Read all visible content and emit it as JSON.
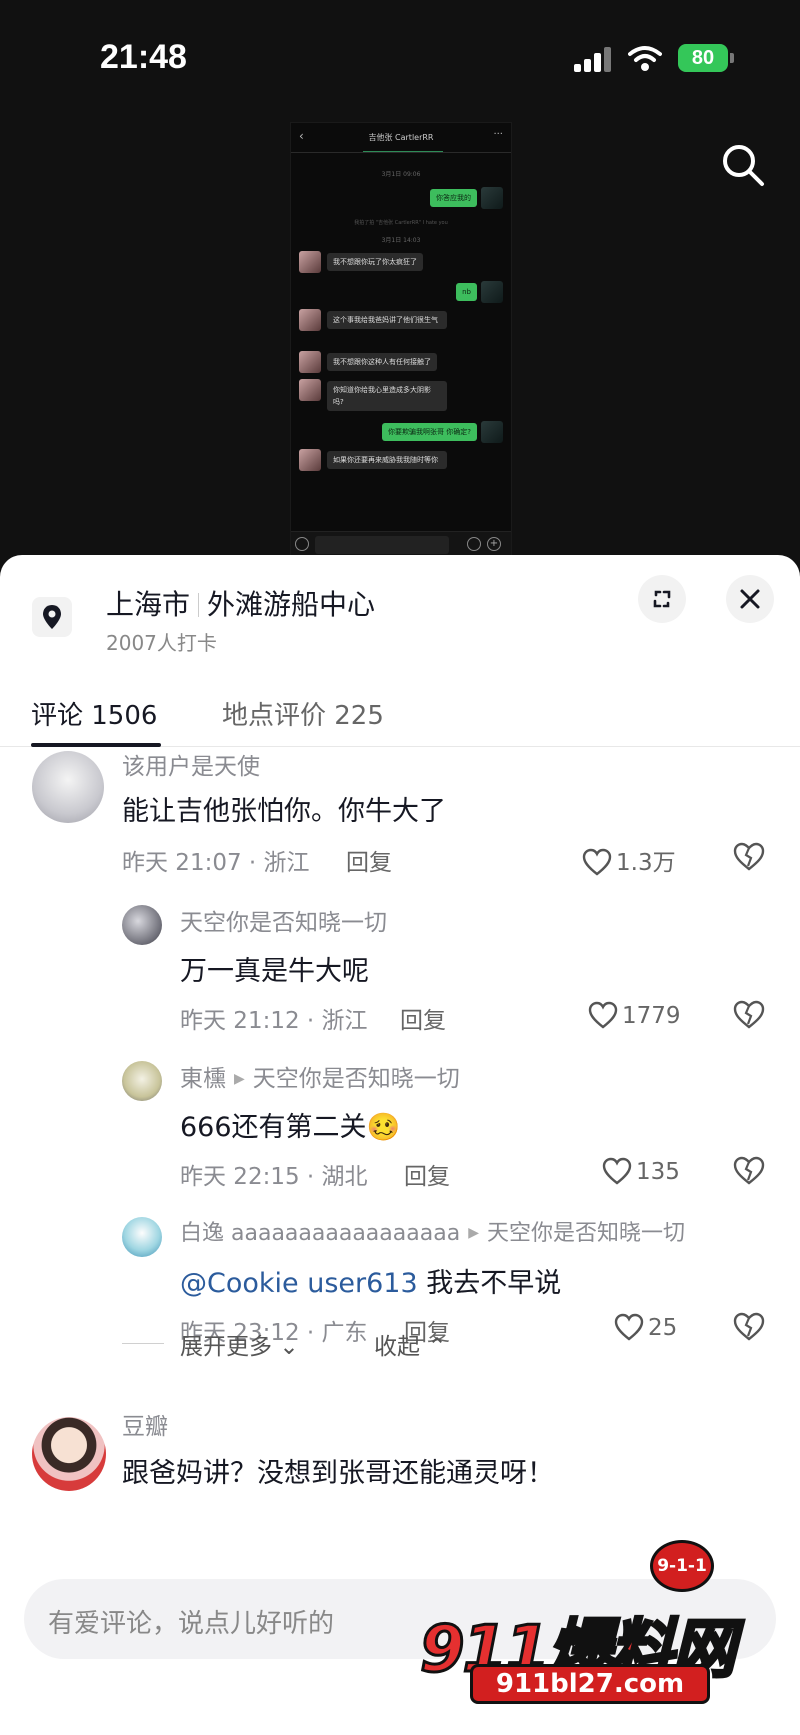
{
  "status_bar": {
    "time": "21:48",
    "battery": "80"
  },
  "chat_screenshot": {
    "title": "吉他张 CartlerRR",
    "time1": "3月1日 09:06",
    "msg_out1": "你答应我的",
    "sys_note": "我拍了拍 \"吉他张 CartlerRR\" I hate you",
    "time2": "3月1日 14:03",
    "msg_in1": "我不想跟你玩了你太疯狂了",
    "msg_out2": "nb",
    "msg_in2": "这个事我给我爸妈讲了他们很生气",
    "msg_in3": "我不想跟你这种人有任何接触了",
    "msg_in4": "你知道你给我心里造成多大阴影吗?",
    "msg_out3": "你要欺骗我啊张哥 你确定?",
    "msg_in5": "如果你还要再来威胁我我随时等你"
  },
  "location": {
    "city": "上海市",
    "place": "外滩游船中心",
    "checkins": "2007人打卡"
  },
  "tabs": {
    "comments": "评论 1506",
    "reviews": "地点评价 225"
  },
  "comments": [
    {
      "user": "该用户是天使",
      "text": "能让吉他张怕你。你牛大了",
      "meta": "昨天 21:07 · 浙江",
      "reply": "回复",
      "likes": "1.3万"
    },
    {
      "user": "天空你是否知晓一切",
      "text": "万一真是牛大呢",
      "meta": "昨天 21:12 · 浙江",
      "reply": "回复",
      "likes": "1779"
    },
    {
      "user": "東櫄",
      "reply_to": "天空你是否知晓一切",
      "text": "666还有第二关",
      "emoji": "🥴",
      "meta": "昨天 22:15 · 湖北",
      "reply": "回复",
      "likes": "135"
    },
    {
      "user": "白逸 aaaaaaaaaaaaaaaaa",
      "reply_to": "天空你是否知晓一切",
      "mention": "@Cookie user613",
      "text": " 我去不早说",
      "meta": "昨天 23:12 · 广东",
      "reply": "回复",
      "likes": "25"
    },
    {
      "user": "豆瓣",
      "text": "跟爸妈讲？没想到张哥还能通灵呀！"
    }
  ],
  "expand": {
    "more": "展开更多",
    "collapse": "收起"
  },
  "input": {
    "placeholder": "有爱评论，说点儿好听的"
  },
  "watermark": {
    "badge": "9-1-1",
    "title": "911爆料网",
    "url": "911bl27.com"
  },
  "colors": {
    "accent_green": "#3dbd5d",
    "mention": "#2b5b9c",
    "watermark_red": "#d21f1f"
  }
}
